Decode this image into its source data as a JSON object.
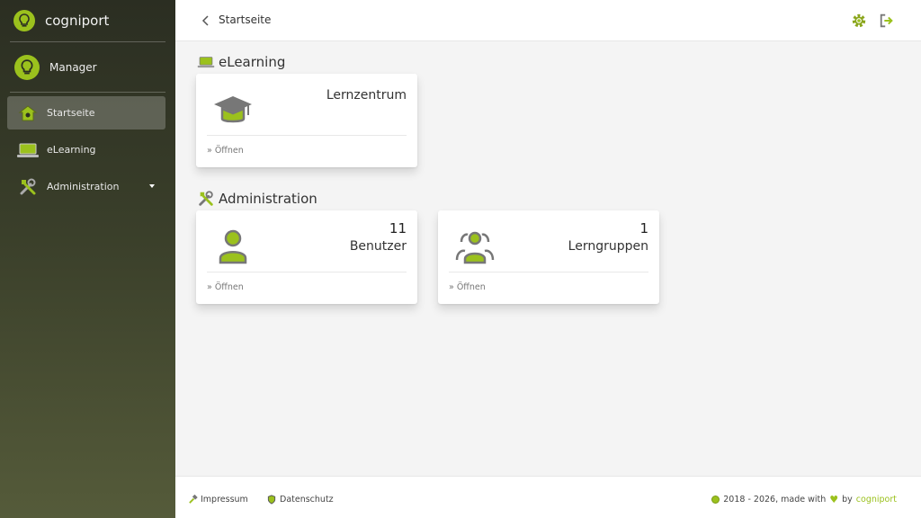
{
  "sidebar": {
    "brand": "cogniport",
    "user": "Manager",
    "items": [
      {
        "label": "Startseite",
        "icon": "home-icon",
        "active": true
      },
      {
        "label": "eLearning",
        "icon": "laptop-icon"
      },
      {
        "label": "Administration",
        "icon": "tools-icon",
        "expandable": true
      }
    ]
  },
  "header": {
    "breadcrumb": "Startseite",
    "icons": [
      "back-chevron-icon",
      "gear-icon",
      "logout-icon"
    ]
  },
  "sections": [
    {
      "title": "eLearning",
      "cards": [
        {
          "title": "Lernzentrum",
          "count": "",
          "action": "» Öffnen",
          "icon": "graduation-cap-icon"
        }
      ]
    },
    {
      "title": "Administration",
      "cards": [
        {
          "title": "Benutzer",
          "count": "11",
          "action": "» Öffnen",
          "icon": "user-icon"
        },
        {
          "title": "Lerngruppen",
          "count": "1",
          "action": "» Öffnen",
          "icon": "user-group-icon"
        }
      ]
    }
  ],
  "footer": {
    "impressum": "Impressum",
    "datenschutz": "Datenschutz",
    "copyright": "2018 - 2026, made with",
    "by": "by",
    "brand": "cogniport"
  },
  "colors": {
    "accent": "#9bc11d",
    "icon_gray": "#7a7a6a",
    "sidebar_top": "#2b2e22",
    "sidebar_bottom": "#555b3a"
  }
}
